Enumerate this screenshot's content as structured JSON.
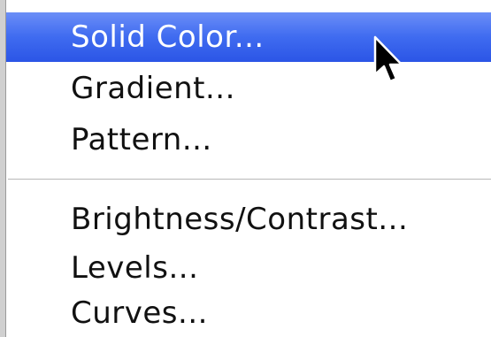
{
  "menu": {
    "items": [
      {
        "label": "Solid Color...",
        "selected": true
      },
      {
        "label": "Gradient..."
      },
      {
        "label": "Pattern..."
      },
      {
        "label": "Brightness/Contrast..."
      },
      {
        "label": "Levels..."
      },
      {
        "label": "Curves..."
      }
    ],
    "highlight_color": "#3f6bf0"
  },
  "cursor": {
    "icon": "arrow-pointer-icon"
  }
}
